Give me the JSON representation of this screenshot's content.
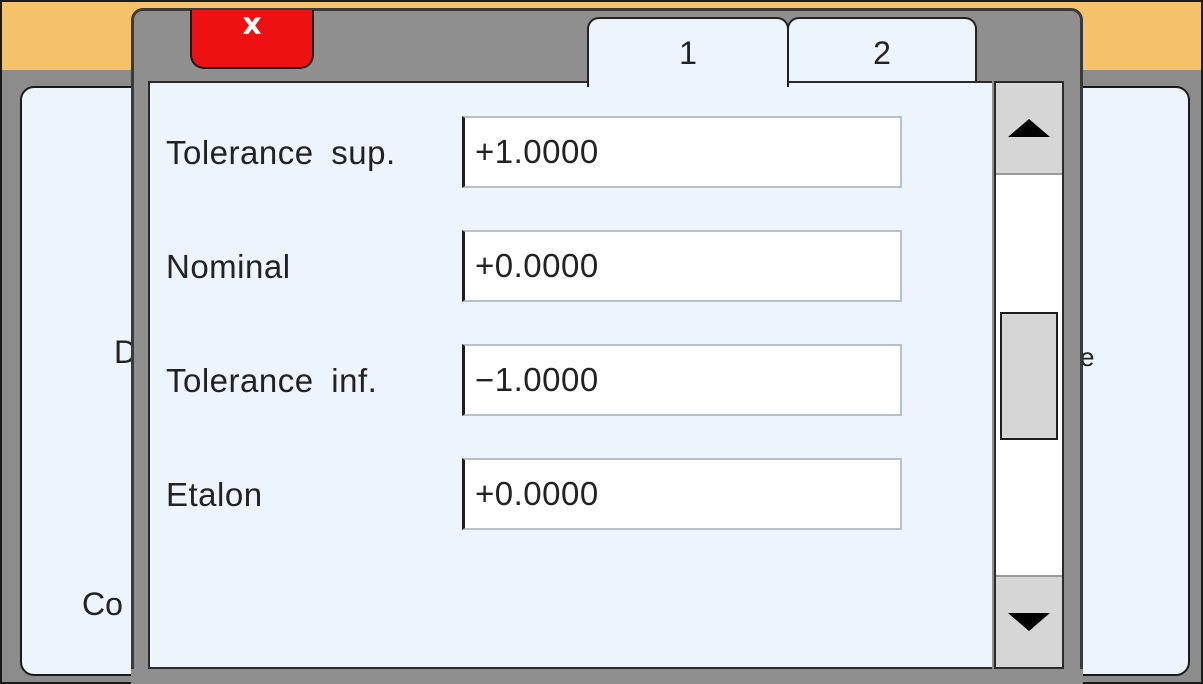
{
  "background": {
    "left_fragment_1": "D",
    "left_fragment_2": "Co",
    "right_fragment_1": "e"
  },
  "dialog": {
    "close_label": "x",
    "tabs": [
      {
        "label": "1",
        "active": true
      },
      {
        "label": "2",
        "active": false
      }
    ],
    "fields": [
      {
        "label": "Tolerance sup.",
        "value": "+1.0000"
      },
      {
        "label": "Nominal",
        "value": "+0.0000"
      },
      {
        "label": "Tolerance inf.",
        "value": "−1.0000"
      },
      {
        "label": "Etalon",
        "value": "+0.0000"
      }
    ]
  },
  "colors": {
    "header_orange": "#f5c26b",
    "close_red": "#ee1111",
    "panel_bg": "#eef4fb",
    "frame_gray": "#8f8f8f"
  },
  "icons": {
    "close": "close-icon",
    "scroll_up": "arrow-up-icon",
    "scroll_down": "arrow-down-icon"
  }
}
